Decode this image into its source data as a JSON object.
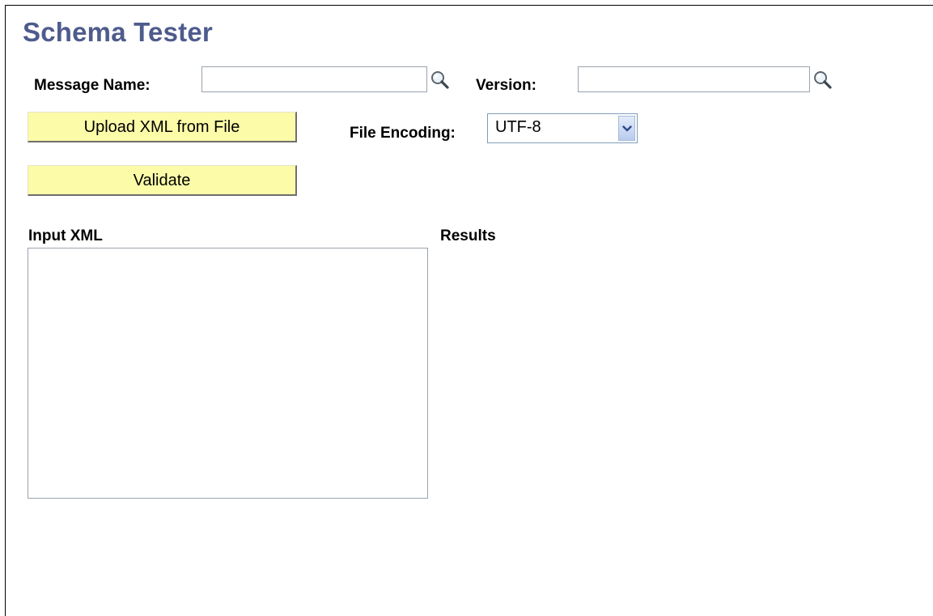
{
  "page": {
    "title": "Schema Tester"
  },
  "form": {
    "message_name": {
      "label": "Message Name:",
      "value": "",
      "lookup_icon": "magnifier-icon"
    },
    "version": {
      "label": "Version:",
      "value": "",
      "lookup_icon": "magnifier-icon"
    },
    "upload_button_label": "Upload XML from File",
    "validate_button_label": "Validate",
    "file_encoding": {
      "label": "File Encoding:",
      "selected": "UTF-8",
      "dropdown_icon": "chevron-down-icon"
    },
    "input_xml": {
      "label": "Input XML",
      "value": ""
    },
    "results": {
      "label": "Results"
    }
  },
  "colors": {
    "title": "#4e5b8c",
    "button_bg": "#fbfba8",
    "input_border": "#9aa3ad"
  }
}
